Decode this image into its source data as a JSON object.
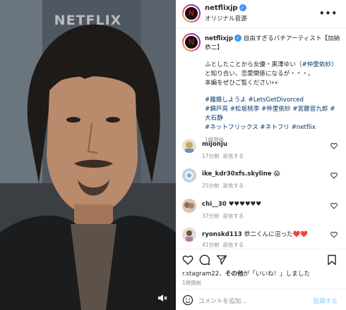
{
  "media": {
    "watermark": "NETFLIX",
    "avatar_glyph": "N"
  },
  "header": {
    "username": "netflixjp",
    "verified": "✓",
    "subtitle": "オリジナル音源",
    "more": "•••"
  },
  "caption": {
    "username": "netflixjp",
    "line1": "自由すぎるバチアーティスト【加納恭二】",
    "para2_a": "ふとしたことから女優・黒澤ゆい（",
    "para2_link": "#仲里依紗",
    "para2_b": "）と知り合い、恋愛関係になるが・・・。",
    "para2_c": "本編をぜひご覧ください👀",
    "tags1": "#離婚しようよ #LetsGetDivorced",
    "tags2": "#錦戸亮 #松坂桃李 #仲里依紗 #宮藤官九郎 #大石静",
    "tags3": "#ネットフリックス #ネトフリ #netflix",
    "time": "1時間前"
  },
  "comments": [
    {
      "username": "mijonju",
      "text": "",
      "time": "17分前",
      "reply": "返信する"
    },
    {
      "username": "ike_kdr30xfs.skyline",
      "text": "😱",
      "time": "25分前",
      "reply": "返信する"
    },
    {
      "username": "chi__30",
      "text": "♥♥♥♥♥♥",
      "time": "37分前",
      "reply": "返信する"
    },
    {
      "username": "ryonskd113",
      "text": "恭二くんに沼った❤️❤️",
      "time": "41分前",
      "reply": "返信する"
    }
  ],
  "likes": {
    "prefix": "r.stagram22、",
    "bold": "その他",
    "suffix": "が「いいね！」しました"
  },
  "post_time": "1時間前",
  "add_comment": {
    "placeholder": "コメントを追加...",
    "post_label": "投稿する"
  },
  "colors": {
    "accent": "#3897f0",
    "link": "#00376b",
    "post_disabled": "#b2dffc",
    "netflix_red": "#e50914"
  }
}
